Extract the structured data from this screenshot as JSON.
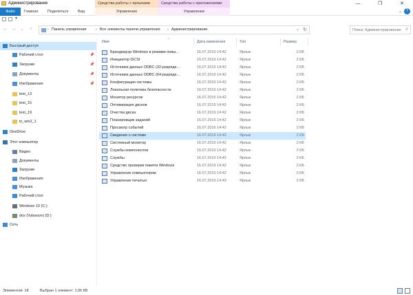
{
  "window": {
    "title": "Администрирование",
    "minimize": "—",
    "maximize": "❐",
    "close": "✕"
  },
  "quick_access_toolbar": {
    "dropdown": "▾"
  },
  "ribbon": {
    "contextual_groups": [
      "Средства работы с ярлыками",
      "Средства работы с приложениями"
    ],
    "tabs": [
      "Файл",
      "Главная",
      "Поделиться",
      "Вид",
      "Управление",
      "Управление"
    ],
    "collapse_glyph": "⌄",
    "help_glyph": "?"
  },
  "navigation": {
    "back": "←",
    "forward": "→",
    "recent": "⌄",
    "up": "↑",
    "breadcrumb": [
      "Панель управления",
      "Все элементы панели управления",
      "Администрирование"
    ],
    "separator": "›",
    "dropdown": "⌄",
    "refresh": "↻"
  },
  "search": {
    "placeholder": "Поиск: Администрирование",
    "icon": "search-icon"
  },
  "nav_pane": [
    {
      "label": "Быстрый доступ",
      "level": 0,
      "icon": "star-icon",
      "selected": true,
      "pinned": false
    },
    {
      "label": "Рабочий стол",
      "level": 1,
      "icon": "desktop-icon",
      "selected": false,
      "pinned": true
    },
    {
      "label": "Загрузки",
      "level": 1,
      "icon": "download-icon",
      "selected": false,
      "pinned": true
    },
    {
      "label": "Документы",
      "level": 1,
      "icon": "document-icon",
      "selected": false,
      "pinned": true
    },
    {
      "label": "Изображения",
      "level": 1,
      "icon": "image-icon",
      "selected": false,
      "pinned": true
    },
    {
      "label": "test_13",
      "level": 1,
      "icon": "folder-icon",
      "selected": false,
      "pinned": false
    },
    {
      "label": "test_15",
      "level": 1,
      "icon": "folder-icon",
      "selected": false,
      "pinned": false
    },
    {
      "label": "test_19",
      "level": 1,
      "icon": "folder-icon",
      "selected": false,
      "pinned": false
    },
    {
      "label": "tz_win2_1",
      "level": 1,
      "icon": "folder-icon",
      "selected": false,
      "pinned": false
    },
    {
      "label": "OneDrive",
      "level": 0,
      "icon": "cloud-icon",
      "selected": false,
      "pinned": false
    },
    {
      "label": "Этот компьютер",
      "level": 0,
      "icon": "computer-icon",
      "selected": false,
      "pinned": false
    },
    {
      "label": "Видео",
      "level": 1,
      "icon": "video-icon",
      "selected": false,
      "pinned": false
    },
    {
      "label": "Документы",
      "level": 1,
      "icon": "document-icon",
      "selected": false,
      "pinned": false
    },
    {
      "label": "Загрузки",
      "level": 1,
      "icon": "download-icon",
      "selected": false,
      "pinned": false
    },
    {
      "label": "Изображения",
      "level": 1,
      "icon": "image-icon",
      "selected": false,
      "pinned": false
    },
    {
      "label": "Музыка",
      "level": 1,
      "icon": "music-icon",
      "selected": false,
      "pinned": false
    },
    {
      "label": "Рабочий стол",
      "level": 1,
      "icon": "desktop-icon",
      "selected": false,
      "pinned": false
    },
    {
      "label": "Windows 10 (C:)",
      "level": 1,
      "icon": "drive-icon",
      "selected": false,
      "pinned": false
    },
    {
      "label": "dos (\\\\vboxsrv) (D:)",
      "level": 1,
      "icon": "network-drive-icon",
      "selected": false,
      "pinned": false
    },
    {
      "label": "Сеть",
      "level": 0,
      "icon": "network-icon",
      "selected": false,
      "pinned": false
    }
  ],
  "columns": {
    "name": "Имя",
    "date": "Дата изменения",
    "type": "Тип",
    "size": "Размер",
    "sort_glyph": "^"
  },
  "files": [
    {
      "name": "Брандмауэр Windows в режиме повы...",
      "date": "16.07.2016 14:42",
      "type": "Ярлык",
      "size": "2 КБ",
      "selected": false
    },
    {
      "name": "Инициатор iSCSI",
      "date": "16.07.2016 14:42",
      "type": "Ярлык",
      "size": "2 КБ",
      "selected": false
    },
    {
      "name": "Источники данных ODBC (32-разряде...",
      "date": "16.07.2016 14:42",
      "type": "Ярлык",
      "size": "2 КБ",
      "selected": false
    },
    {
      "name": "Источники данных ODBC (64-разряде...",
      "date": "16.07.2016 14:42",
      "type": "Ярлык",
      "size": "2 КБ",
      "selected": false
    },
    {
      "name": "Конфигурация системы",
      "date": "16.07.2016 14:42",
      "type": "Ярлык",
      "size": "2 КБ",
      "selected": false
    },
    {
      "name": "Локальная политика безопасности",
      "date": "16.07.2016 14:42",
      "type": "Ярлык",
      "size": "2 КБ",
      "selected": false
    },
    {
      "name": "Монитор ресурсов",
      "date": "16.07.2016 14:42",
      "type": "Ярлык",
      "size": "2 КБ",
      "selected": false
    },
    {
      "name": "Оптимизация дисков",
      "date": "16.07.2016 14:42",
      "type": "Ярлык",
      "size": "2 КБ",
      "selected": false
    },
    {
      "name": "Очистка диска",
      "date": "16.07.2016 14:42",
      "type": "Ярлык",
      "size": "2 КБ",
      "selected": false
    },
    {
      "name": "Планировщик заданий",
      "date": "16.07.2016 14:42",
      "type": "Ярлык",
      "size": "2 КБ",
      "selected": false
    },
    {
      "name": "Просмотр событий",
      "date": "16.07.2016 14:42",
      "type": "Ярлык",
      "size": "2 КБ",
      "selected": false
    },
    {
      "name": "Сведения о системе",
      "date": "16.07.2016 14:42",
      "type": "Ярлык",
      "size": "2 КБ",
      "selected": true
    },
    {
      "name": "Системный монитор",
      "date": "16.07.2016 14:42",
      "type": "Ярлык",
      "size": "2 КБ",
      "selected": false
    },
    {
      "name": "Службы компонентов",
      "date": "16.07.2016 14:42",
      "type": "Ярлык",
      "size": "2 КБ",
      "selected": false
    },
    {
      "name": "Службы",
      "date": "16.07.2016 14:42",
      "type": "Ярлык",
      "size": "2 КБ",
      "selected": false
    },
    {
      "name": "Средство проверки памяти Windows",
      "date": "16.07.2016 14:42",
      "type": "Ярлык",
      "size": "2 КБ",
      "selected": false
    },
    {
      "name": "Управление компьютером",
      "date": "16.07.2016 14:42",
      "type": "Ярлык",
      "size": "2 КБ",
      "selected": false
    },
    {
      "name": "Управление печатью",
      "date": "16.07.2016 14:43",
      "type": "Ярлык",
      "size": "2 КБ",
      "selected": false
    }
  ],
  "status": {
    "items": "Элементов: 18",
    "selected": "Выбран 1 элемент: 1,06 КБ"
  },
  "colors": {
    "accent": "#1979ca",
    "selection": "#cce8ff",
    "ctx_shortcut": "#fde0c2",
    "ctx_app": "#f3d7f7"
  }
}
